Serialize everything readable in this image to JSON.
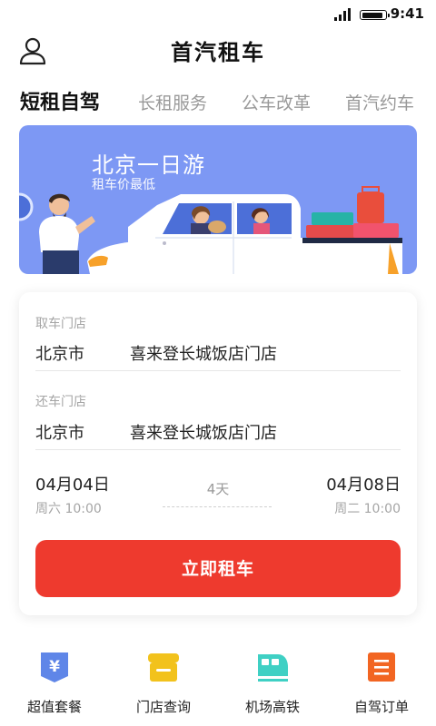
{
  "status_bar": {
    "time": "9:41"
  },
  "header": {
    "title": "首汽租车",
    "profile_icon": "user-icon"
  },
  "tabs": [
    {
      "label": "短租自驾",
      "active": true
    },
    {
      "label": "长租服务",
      "active": false
    },
    {
      "label": "公车改革",
      "active": false
    },
    {
      "label": "首汽约车",
      "active": false
    }
  ],
  "banner": {
    "title": "北京一日游",
    "subtitle": "租车价最低"
  },
  "booking": {
    "pickup": {
      "label": "取车门店",
      "city": "北京市",
      "store": "喜来登长城饭店门店"
    },
    "return": {
      "label": "还车门店",
      "city": "北京市",
      "store": "喜来登长城饭店门店"
    },
    "start": {
      "date": "04月04日",
      "weekday_time": "周六 10:00"
    },
    "end": {
      "date": "04月08日",
      "weekday_time": "周二 10:00"
    },
    "duration": "4天",
    "button_label": "立即租车"
  },
  "bottom_nav": [
    {
      "label": "超值套餐",
      "icon": "yen-shield-icon",
      "color": "#5f86e8"
    },
    {
      "label": "门店查询",
      "icon": "store-icon",
      "color": "#f2c21c"
    },
    {
      "label": "机场高铁",
      "icon": "train-icon",
      "color": "#3fd0c4"
    },
    {
      "label": "自驾订单",
      "icon": "order-list-icon",
      "color": "#f26522"
    }
  ],
  "colors": {
    "primary_red": "#ee3a2e",
    "banner_blue": "#7d98f4"
  }
}
